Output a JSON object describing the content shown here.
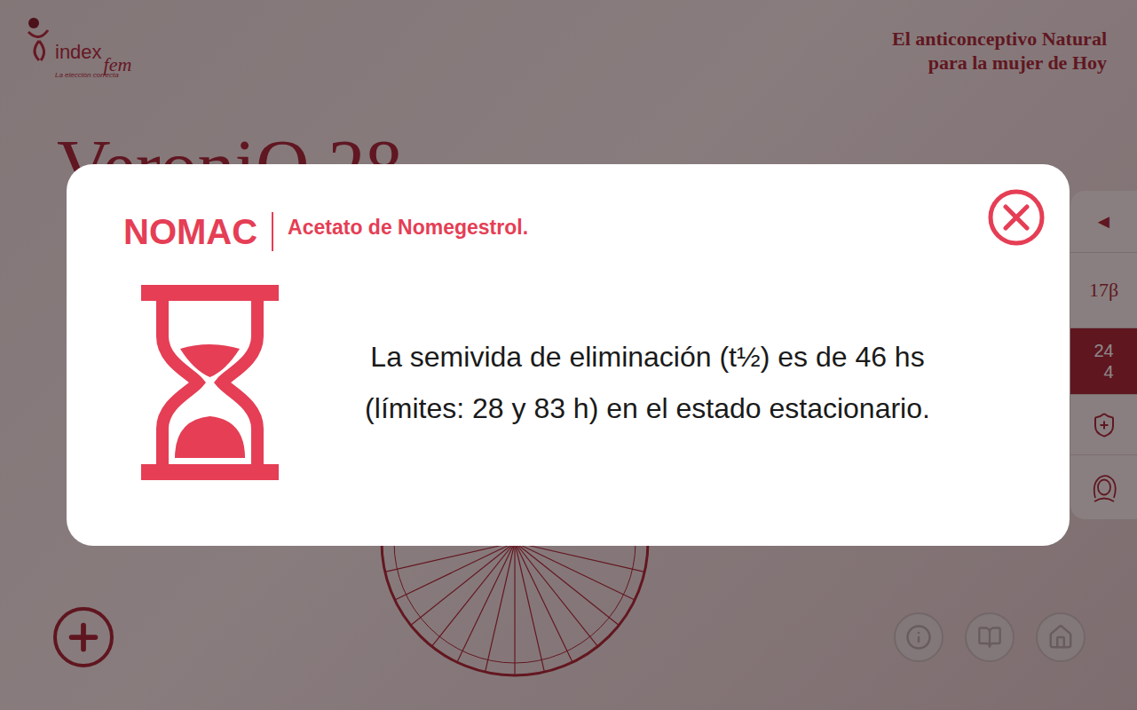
{
  "logo": {
    "name": "index",
    "suffix": "fem",
    "tagline": "La elección correcta"
  },
  "slogan": [
    "El anticonceptivo Natural",
    "para la mujer de Hoy"
  ],
  "product": {
    "title": "VeroniQ 28"
  },
  "side_tabs": [
    {
      "kind": "text",
      "label": "◄",
      "selected": false
    },
    {
      "kind": "text",
      "label": "17β",
      "selected": false
    },
    {
      "kind": "fraction",
      "label": "24",
      "sub": "4",
      "selected": true
    },
    {
      "kind": "shield",
      "selected": false
    },
    {
      "kind": "face",
      "selected": false
    }
  ],
  "wheel": {
    "segments": 28
  },
  "footer_buttons": [
    {
      "kind": "info"
    },
    {
      "kind": "book"
    },
    {
      "kind": "home"
    }
  ],
  "modal": {
    "open": true,
    "title": "NOMAC",
    "subtitle": "Acetato de Nomegestrol.",
    "text": [
      "La semivida de eliminación (t½) es de 46 hs",
      "(límites: 28 y 83 h) en el estado estacionario."
    ]
  }
}
